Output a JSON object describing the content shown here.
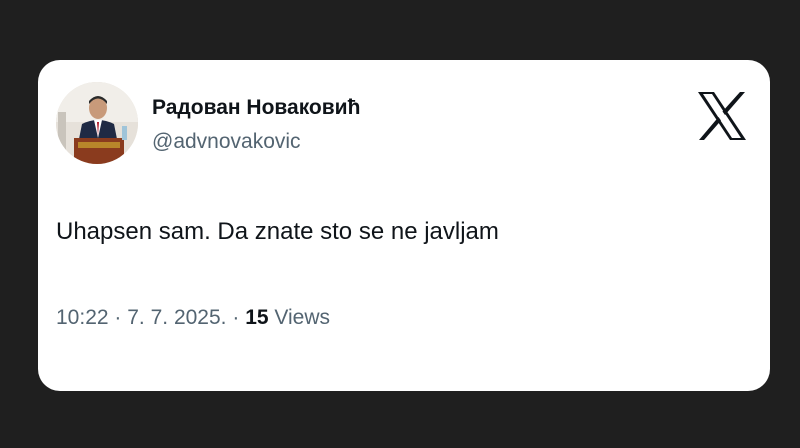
{
  "tweet": {
    "author": {
      "display_name": "Радован Новаковић",
      "handle": "@advnovakovic"
    },
    "platform_icon": "x-logo-icon",
    "text": "Uhapsen sam. Da znate sto se ne javljam",
    "time": "10:22",
    "separator": "·",
    "date": "7. 7. 2025.",
    "views_count": "15",
    "views_label": "Views"
  },
  "colors": {
    "page_background": "#1f1f1f",
    "card_background": "#ffffff",
    "primary_text": "#0f1419",
    "secondary_text": "#536471"
  }
}
